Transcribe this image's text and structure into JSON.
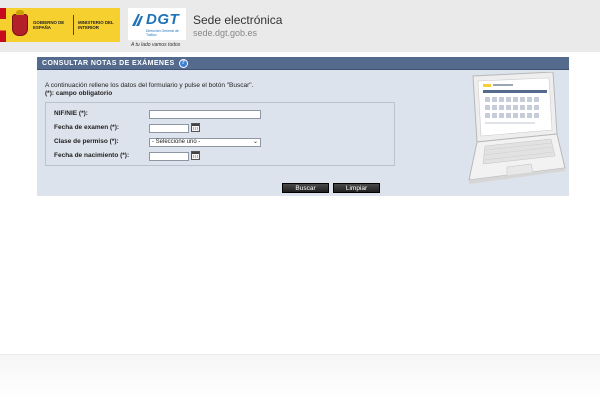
{
  "header": {
    "gov_line1": "GOBIERNO DE ESPAÑA",
    "ministry": "MINISTERIO DEL INTERIOR",
    "dgt_word": "DGT",
    "dgt_subtitle": "Dirección General de Tráfico",
    "tagline": "A tu lado vamos todos",
    "site_title": "Sede electrónica",
    "site_url": "sede.dgt.gob.es"
  },
  "panel": {
    "title": "CONSULTAR NOTAS DE EXÁMENES",
    "help_glyph": "?",
    "intro": "A continuación rellene los datos del formulario y pulse el botón \"Buscar\".",
    "required_note": "(*): campo obligatorio"
  },
  "form": {
    "nif_label": "NIF/NIE (*):",
    "nif_value": "",
    "exam_date_label": "Fecha de examen (*):",
    "exam_date_value": "",
    "permit_label": "Clase de permiso (*):",
    "permit_selected": "- Seleccione uno -",
    "birth_date_label": "Fecha de nacimiento (*):",
    "birth_date_value": ""
  },
  "buttons": {
    "search": "Buscar",
    "clear": "Limpiar"
  },
  "colors": {
    "panel_header": "#556b8d",
    "panel_body": "#dde3ec",
    "dgt_blue": "#1d72b8",
    "gov_yellow": "#f6d02e"
  }
}
